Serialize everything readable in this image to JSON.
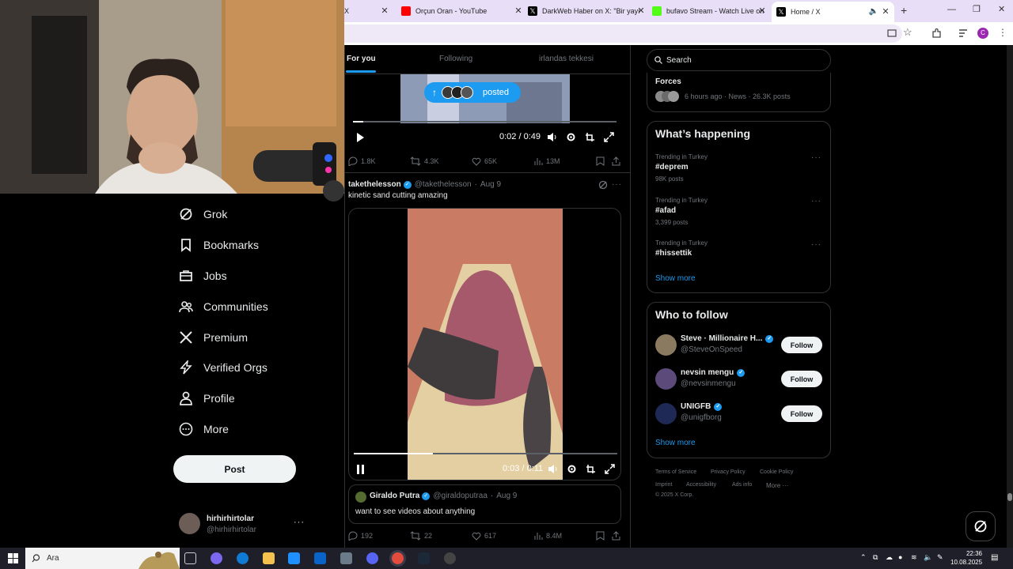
{
  "browser": {
    "tabs": [
      {
        "title": "X",
        "color": "#000000"
      },
      {
        "title": "Orçun Oran - YouTube",
        "color": "#ff0000"
      },
      {
        "title": "DarkWeb Haber on X: \"Bir yayı",
        "color": "#000000"
      },
      {
        "title": "bufavo Stream - Watch Live on",
        "color": "#53fc18"
      },
      {
        "title": "Home / X",
        "color": "#000000"
      }
    ],
    "window_controls": [
      "minimize",
      "maximize",
      "close"
    ]
  },
  "nav": {
    "items": [
      {
        "label": "Grok",
        "icon": "grok-icon"
      },
      {
        "label": "Bookmarks",
        "icon": "bookmark-icon"
      },
      {
        "label": "Jobs",
        "icon": "briefcase-icon"
      },
      {
        "label": "Communities",
        "icon": "people-icon"
      },
      {
        "label": "Premium",
        "icon": "x-logo-icon"
      },
      {
        "label": "Verified Orgs",
        "icon": "lightning-icon"
      },
      {
        "label": "Profile",
        "icon": "person-icon"
      },
      {
        "label": "More",
        "icon": "more-circle-icon"
      }
    ],
    "post_label": "Post",
    "account": {
      "name": "hirhirhirtolar",
      "handle": "@hirhirhirtolar"
    }
  },
  "timeline": {
    "tabs": [
      "For you",
      "Following",
      "irlandas tekkesi"
    ],
    "pill_label": "posted",
    "video1": {
      "time": "0:02 / 0:49",
      "progress": 0.04
    },
    "stats1": {
      "replies": "1.8K",
      "reposts": "4.3K",
      "likes": "65K",
      "views": "13M"
    },
    "post": {
      "name": "takethelesson",
      "handle": "@takethelesson",
      "date": "Aug 9",
      "text": "kinetic sand cutting amazing",
      "video_time": "0:03 / 0:11",
      "progress": 0.3
    },
    "quote": {
      "name": "Giraldo Putra",
      "handle": "@giraldoputraa",
      "date": "Aug 9",
      "text": "want to see videos about anything"
    },
    "stats2": {
      "replies": "192",
      "reposts": "22",
      "likes": "617",
      "views": "8.4M"
    }
  },
  "sidebar": {
    "search_placeholder": "Search",
    "news": {
      "headline_partial": "Forces",
      "meta": "6 hours ago · News · 26.3K posts"
    },
    "whats_happening": {
      "title": "What’s happening",
      "trends": [
        {
          "context": "Trending in Turkey",
          "name": "#deprem",
          "count": "98K posts"
        },
        {
          "context": "Trending in Turkey",
          "name": "#afad",
          "count": "3,399 posts"
        },
        {
          "context": "Trending in Turkey",
          "name": "#hissettik",
          "count": ""
        }
      ],
      "show_more": "Show more"
    },
    "who_to_follow": {
      "title": "Who to follow",
      "accounts": [
        {
          "name": "Steve · Millionaire H...",
          "handle": "@SteveOnSpeed",
          "button": "Follow"
        },
        {
          "name": "nevsin mengu",
          "handle": "@nevsinmengu",
          "button": "Follow"
        },
        {
          "name": "UNIGFB",
          "handle": "@unigfborg",
          "button": "Follow"
        }
      ],
      "show_more": "Show more"
    },
    "footer": {
      "links": [
        "Terms of Service",
        "Privacy Policy",
        "Cookie Policy",
        "Imprint",
        "Accessibility",
        "Ads info",
        "More ···"
      ],
      "copyright": "© 2025 X Corp."
    }
  },
  "taskbar": {
    "search_placeholder": "Ara",
    "time": "22:36",
    "date": "10.08.2025"
  },
  "colors": {
    "accent": "#1d9bf0",
    "background": "#000000",
    "border": "#2f3336"
  }
}
